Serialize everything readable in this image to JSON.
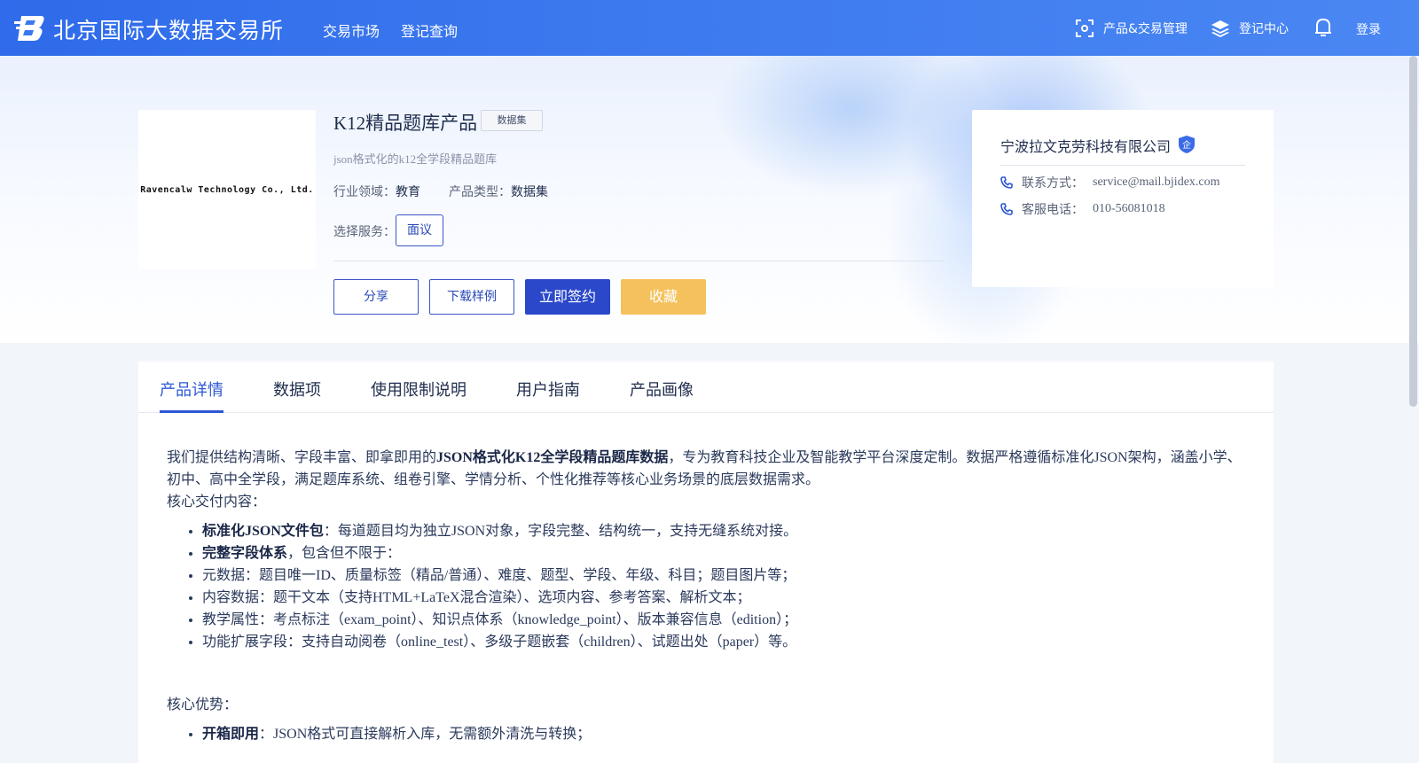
{
  "header": {
    "brand": "北京国际大数据交易所",
    "nav": [
      "交易市场",
      "登记查询"
    ],
    "right_nav": [
      {
        "label": "产品&交易管理",
        "icon": "scan-icon"
      },
      {
        "label": "登记中心",
        "icon": "layers-icon"
      }
    ],
    "login": "登录"
  },
  "product": {
    "logo_text": "Ravencalw Technology Co., Ltd.",
    "title": "K12精品题库产品",
    "tag": "数据集",
    "description": "json格式化的k12全学段精品题库",
    "industry_label": "行业领域：",
    "industry_value": "教育",
    "type_label": "产品类型：",
    "type_value": "数据集",
    "service_label": "选择服务：",
    "service_option": "面议",
    "buttons": {
      "share": "分享",
      "download": "下载样例",
      "sign": "立即签约",
      "favorite": "收藏"
    }
  },
  "company": {
    "name": "宁波拉文克劳科技有限公司",
    "badge": "企",
    "contact_label": "联系方式：",
    "contact_value": "service@mail.bjidex.com",
    "phone_label": "客服电话：",
    "phone_value": "010-56081018"
  },
  "tabs": [
    "产品详情",
    "数据项",
    "使用限制说明",
    "用户指南",
    "产品画像"
  ],
  "detail": {
    "intro_pre": "我们提供结构清晰、字段丰富、即拿即用的",
    "intro_bold": "JSON格式化K12全学段精品题库数据",
    "intro_post": "，专为教育科技企业及智能教学平台深度定制。数据严格遵循标准化JSON架构，涵盖小学、初中、高中全学段，满足题库系统、组卷引擎、学情分析、个性化推荐等核心业务场景的底层数据需求。",
    "core_title": "核心交付内容：",
    "items": [
      {
        "bold": "标准化JSON文件包",
        "text": "：每道题目均为独立JSON对象，字段完整、结构统一，支持无缝系统对接。"
      },
      {
        "bold": "完整字段体系",
        "text": "，包含但不限于："
      },
      {
        "bold": "",
        "text": "元数据：题目唯一ID、质量标签（精品/普通）、难度、题型、学段、年级、科目；题目图片等；"
      },
      {
        "bold": "",
        "text": "内容数据：题干文本（支持HTML+LaTeX混合渲染）、选项内容、参考答案、解析文本；"
      },
      {
        "bold": "",
        "text": "教学属性：考点标注（exam_point）、知识点体系（knowledge_point）、版本兼容信息（edition）；"
      },
      {
        "bold": "",
        "text": "功能扩展字段：支持自动阅卷（online_test）、多级子题嵌套（children）、试题出处（paper）等。"
      }
    ],
    "advantage_title": "核心优势：",
    "advantages": [
      {
        "bold": "开箱即用",
        "text": "：JSON格式可直接解析入库，无需额外清洗与转换；"
      }
    ]
  },
  "colors": {
    "primary": "#2a48c9",
    "accent": "#f5c15c",
    "header": "#3b78ee"
  }
}
